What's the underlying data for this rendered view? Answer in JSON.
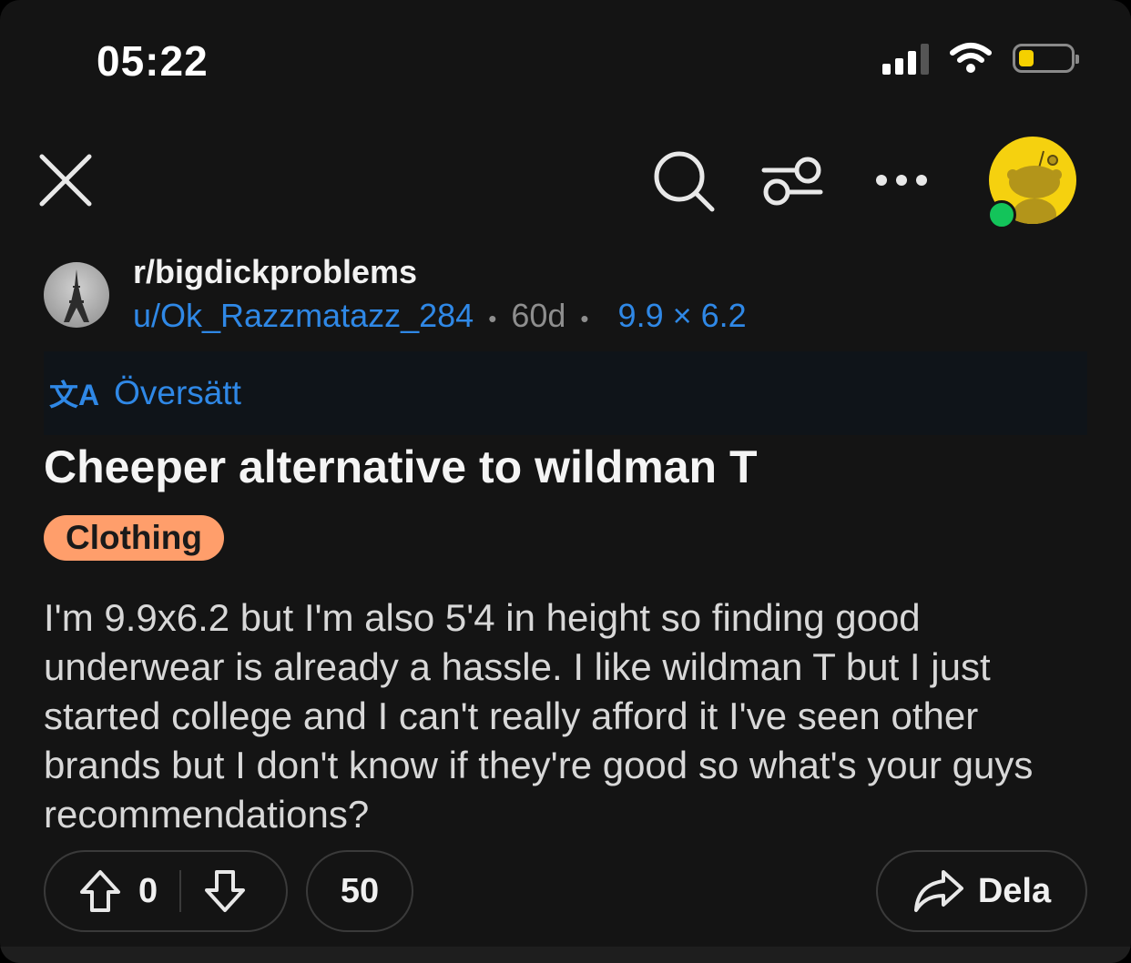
{
  "status_bar": {
    "time": "05:22"
  },
  "header": {
    "close_icon": "close-icon",
    "search_icon": "search-icon",
    "filter_icon": "sliders-icon",
    "more_icon": "more-icon"
  },
  "post": {
    "subreddit": "r/bigdickproblems",
    "author": "u/Ok_Razzmatazz_284",
    "separator": "•",
    "age": "60d",
    "user_flair": "9.9 × 6.2",
    "translate_icon": "文A",
    "translate_label": "Översätt",
    "title": "Cheeper alternative to wildman T",
    "flair": "Clothing",
    "body": "I'm 9.9x6.2 but I'm also 5'4 in height so finding good underwear is already a hassle. I like wildman T but I just started college and I can't really afford it I've seen other brands but I don't know if they're good so what's your guys recommendations?"
  },
  "actions": {
    "votes": "0",
    "comments": "50",
    "share_label": "Dela"
  },
  "colors": {
    "background": "#141414",
    "link_blue": "#2f88e6",
    "flair_bg": "#ff9e6b",
    "avatar_yellow": "#f5d10f",
    "online_green": "#13c45a"
  }
}
